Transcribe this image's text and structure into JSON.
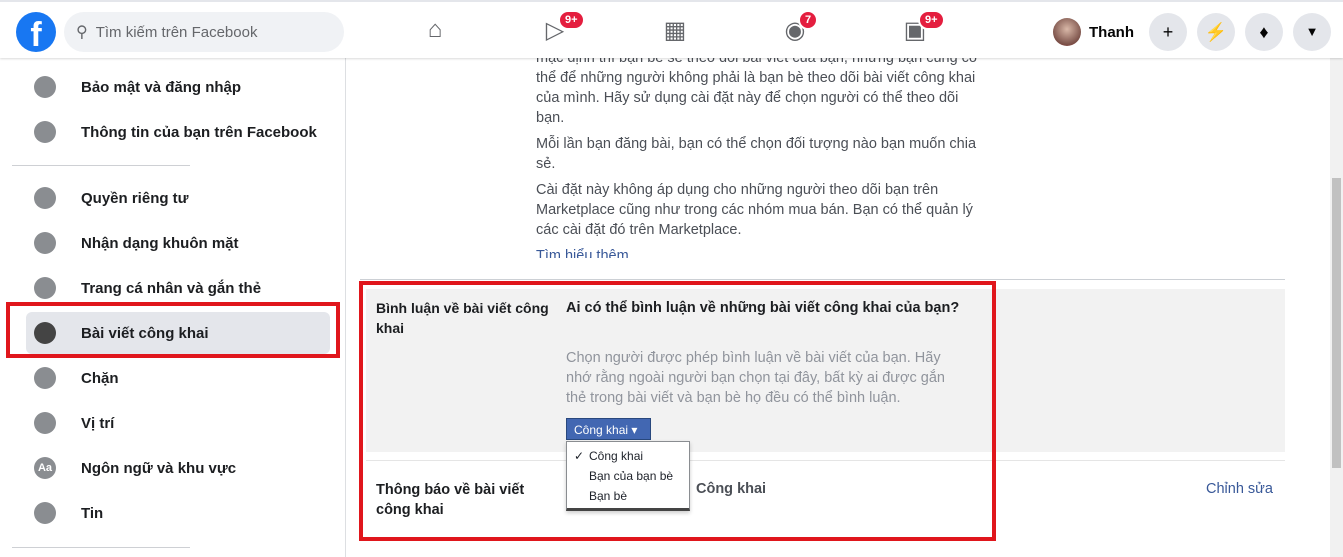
{
  "header": {
    "search_placeholder": "Tìm kiếm trên Facebook",
    "badges": {
      "watch": "9+",
      "groups": "7",
      "gaming": "9+"
    },
    "user_name": "Thanh",
    "icons": [
      "home-icon",
      "watch-icon",
      "marketplace-icon",
      "groups-icon",
      "gaming-icon",
      "plus-icon",
      "messenger-icon",
      "bell-icon",
      "caret-down-icon"
    ]
  },
  "sidebar": {
    "items": [
      {
        "label": "Bảo mật và đăng nhập",
        "icon": "shield-icon"
      },
      {
        "label": "Thông tin của bạn trên Facebook",
        "icon": "grid-icon"
      },
      {
        "label": "Quyền riêng tư",
        "icon": "lock-icon"
      },
      {
        "label": "Nhận dạng khuôn mặt",
        "icon": "face-icon"
      },
      {
        "label": "Trang cá nhân và gắn thẻ",
        "icon": "tag-icon"
      },
      {
        "label": "Bài viết công khai",
        "icon": "globe-icon",
        "selected": true
      },
      {
        "label": "Chặn",
        "icon": "block-user-icon"
      },
      {
        "label": "Vị trí",
        "icon": "location-pin-icon"
      },
      {
        "label": "Ngôn ngữ và khu vực",
        "icon": "language-icon"
      },
      {
        "label": "Tin",
        "icon": "book-icon"
      }
    ]
  },
  "main": {
    "intro": [
      "mặc định thì bạn bè sẽ theo dõi bài viết của bạn, nhưng bạn cũng có thể để những người không phải là bạn bè theo dõi bài viết công khai của mình. Hãy sử dụng cài đặt này để chọn người có thể theo dõi bạn.",
      "Mỗi lần bạn đăng bài, bạn có thể chọn đối tượng nào bạn muốn chia sẻ.",
      "Cài đặt này không áp dụng cho những người theo dõi bạn trên Marketplace cũng như trong các nhóm mua bán. Bạn có thể quản lý các cài đặt đó trên Marketplace."
    ],
    "learn_more": "Tìm hiểu thêm",
    "comments": {
      "label": "Bình luận về bài viết công khai",
      "question": "Ai có thể bình luận về những bài viết công khai của bạn?",
      "desc": "Chọn người được phép bình luận về bài viết của bạn. Hãy nhớ rằng ngoài người bạn chọn tại đây, bất kỳ ai được gắn thẻ trong bài viết và bạn bè họ đều có thể bình luận.",
      "selected": "Công khai",
      "options": [
        "Công khai",
        "Bạn của bạn bè",
        "Bạn bè"
      ]
    },
    "notifications": {
      "label": "Thông báo về bài viết công khai",
      "value": "Công khai",
      "edit": "Chỉnh sửa"
    }
  },
  "colors": {
    "brand": "#1877f2",
    "highlight": "#e0161c",
    "dropdown": "#4267b2",
    "link": "#385898"
  }
}
